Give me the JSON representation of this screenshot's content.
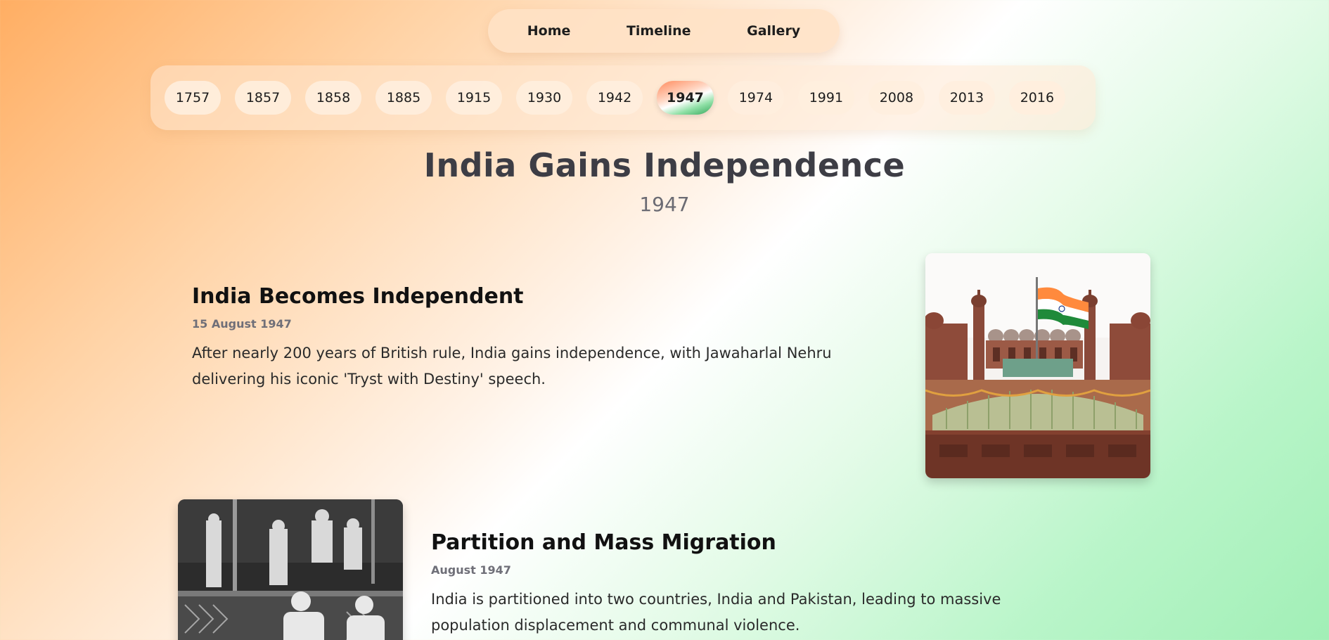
{
  "nav": {
    "links": [
      {
        "label": "Home"
      },
      {
        "label": "Timeline"
      },
      {
        "label": "Gallery"
      }
    ]
  },
  "years": {
    "items": [
      "1757",
      "1857",
      "1858",
      "1885",
      "1915",
      "1930",
      "1942",
      "1947",
      "1974",
      "1991",
      "2008",
      "2013",
      "2016"
    ],
    "selected": "1947"
  },
  "header": {
    "title": "India Gains Independence",
    "year": "1947"
  },
  "events": [
    {
      "title": "India Becomes Independent",
      "date": "15 August 1947",
      "description": "After nearly 200 years of British rule, India gains independence, with Jawaharlal Nehru delivering his iconic 'Tryst with Destiny' speech."
    },
    {
      "title": "Partition and Mass Migration",
      "date": "August 1947",
      "description": "India is partitioned into two countries, India and Pakistan, leading to massive population displacement and communal violence."
    }
  ],
  "colors": {
    "saffron": "#ff9933",
    "white": "#ffffff",
    "green": "#138808"
  }
}
